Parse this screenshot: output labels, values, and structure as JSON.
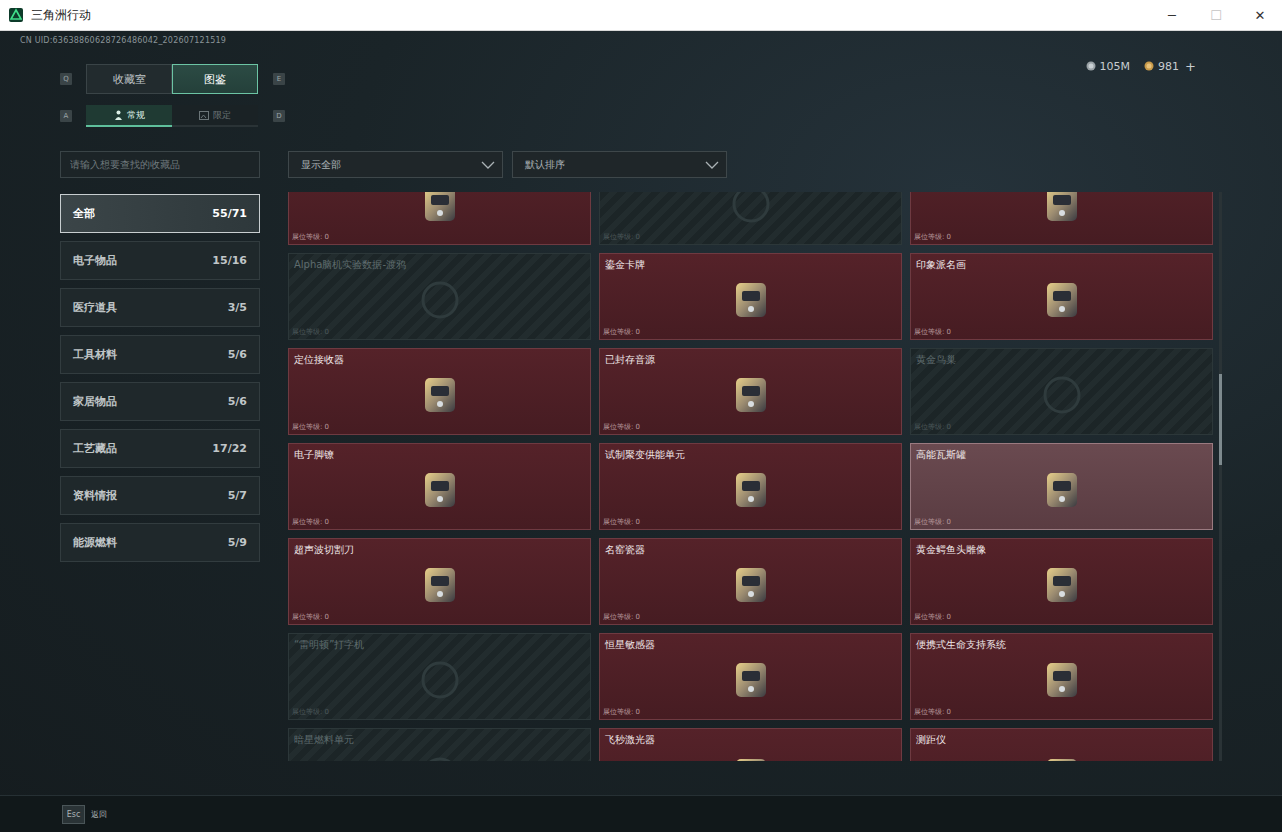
{
  "window": {
    "title": "三角洲行动",
    "controls": [
      "─",
      "☐",
      "✕"
    ]
  },
  "uid": "CN UID:63638860628726486042_202607121519",
  "main_tabs": {
    "prev_key": "Q",
    "next_key": "E",
    "items": [
      {
        "label": "收藏室",
        "selected": false
      },
      {
        "label": "图鉴",
        "selected": true
      }
    ]
  },
  "sub_tabs": {
    "prev_key": "A",
    "next_key": "D",
    "items": [
      {
        "label": "常规",
        "selected": true
      },
      {
        "label": "限定",
        "selected": false
      }
    ]
  },
  "currency": [
    {
      "amount": "105M"
    },
    {
      "amount": "981"
    }
  ],
  "add_button": "+",
  "search": {
    "placeholder": "请输入想要查找的收藏品"
  },
  "filters": [
    {
      "label": "显示全部"
    },
    {
      "label": "默认排序"
    }
  ],
  "categories": [
    {
      "name": "全部",
      "count": "55/71",
      "selected": true
    },
    {
      "name": "电子物品",
      "count": "15/16",
      "selected": false
    },
    {
      "name": "医疗道具",
      "count": "3/5",
      "selected": false
    },
    {
      "name": "工具材料",
      "count": "5/6",
      "selected": false
    },
    {
      "name": "家居物品",
      "count": "5/6",
      "selected": false
    },
    {
      "name": "工艺藏品",
      "count": "17/22",
      "selected": false
    },
    {
      "name": "资料情报",
      "count": "5/7",
      "selected": false
    },
    {
      "name": "能源燃料",
      "count": "5/9",
      "selected": false
    }
  ],
  "scrollbar": {
    "thumb_start": 0.32,
    "thumb_size": 0.16
  },
  "cards": [
    {
      "name": "",
      "collected": true,
      "hovered": false,
      "level_text": "展位等级: 0"
    },
    {
      "name": "",
      "collected": false,
      "hovered": false,
      "level_text": "展位等级: 0"
    },
    {
      "name": "",
      "collected": true,
      "hovered": false,
      "level_text": "展位等级: 0"
    },
    {
      "name": "Alpha脑机实验数据-渡鸦",
      "collected": false,
      "hovered": false,
      "level_text": "展位等级: 0"
    },
    {
      "name": "鎏金卡牌",
      "collected": true,
      "hovered": false,
      "level_text": "展位等级: 0"
    },
    {
      "name": "印象派名画",
      "collected": true,
      "hovered": false,
      "level_text": "展位等级: 0"
    },
    {
      "name": "定位接收器",
      "collected": true,
      "hovered": false,
      "level_text": "展位等级: 0"
    },
    {
      "name": "已封存音源",
      "collected": true,
      "hovered": false,
      "level_text": "展位等级: 0"
    },
    {
      "name": "黄金鸟巢",
      "collected": false,
      "hovered": false,
      "level_text": "展位等级: 0"
    },
    {
      "name": "电子脚镣",
      "collected": true,
      "hovered": false,
      "level_text": "展位等级: 0"
    },
    {
      "name": "试制聚变供能单元",
      "collected": true,
      "hovered": false,
      "level_text": "展位等级: 0"
    },
    {
      "name": "高能瓦斯罐",
      "collected": true,
      "hovered": true,
      "level_text": "展位等级: 0"
    },
    {
      "name": "超声波切割刀",
      "collected": true,
      "hovered": false,
      "level_text": "展位等级: 0"
    },
    {
      "name": "名窑瓷器",
      "collected": true,
      "hovered": false,
      "level_text": "展位等级: 0"
    },
    {
      "name": "黄金鳄鱼头雕像",
      "collected": true,
      "hovered": false,
      "level_text": "展位等级: 0"
    },
    {
      "name": "“雷明顿”打字机",
      "collected": false,
      "hovered": false,
      "level_text": "展位等级: 0"
    },
    {
      "name": "恒星敏感器",
      "collected": true,
      "hovered": false,
      "level_text": "展位等级: 0"
    },
    {
      "name": "便携式生命支持系统",
      "collected": true,
      "hovered": false,
      "level_text": "展位等级: 0"
    },
    {
      "name": "暗星燃料单元",
      "collected": false,
      "hovered": false,
      "level_text": ""
    },
    {
      "name": "飞秒激光器",
      "collected": true,
      "hovered": false,
      "level_text": ""
    },
    {
      "name": "测距仪",
      "collected": true,
      "hovered": false,
      "level_text": ""
    }
  ],
  "footer": {
    "key": "Esc",
    "label": "返回"
  }
}
